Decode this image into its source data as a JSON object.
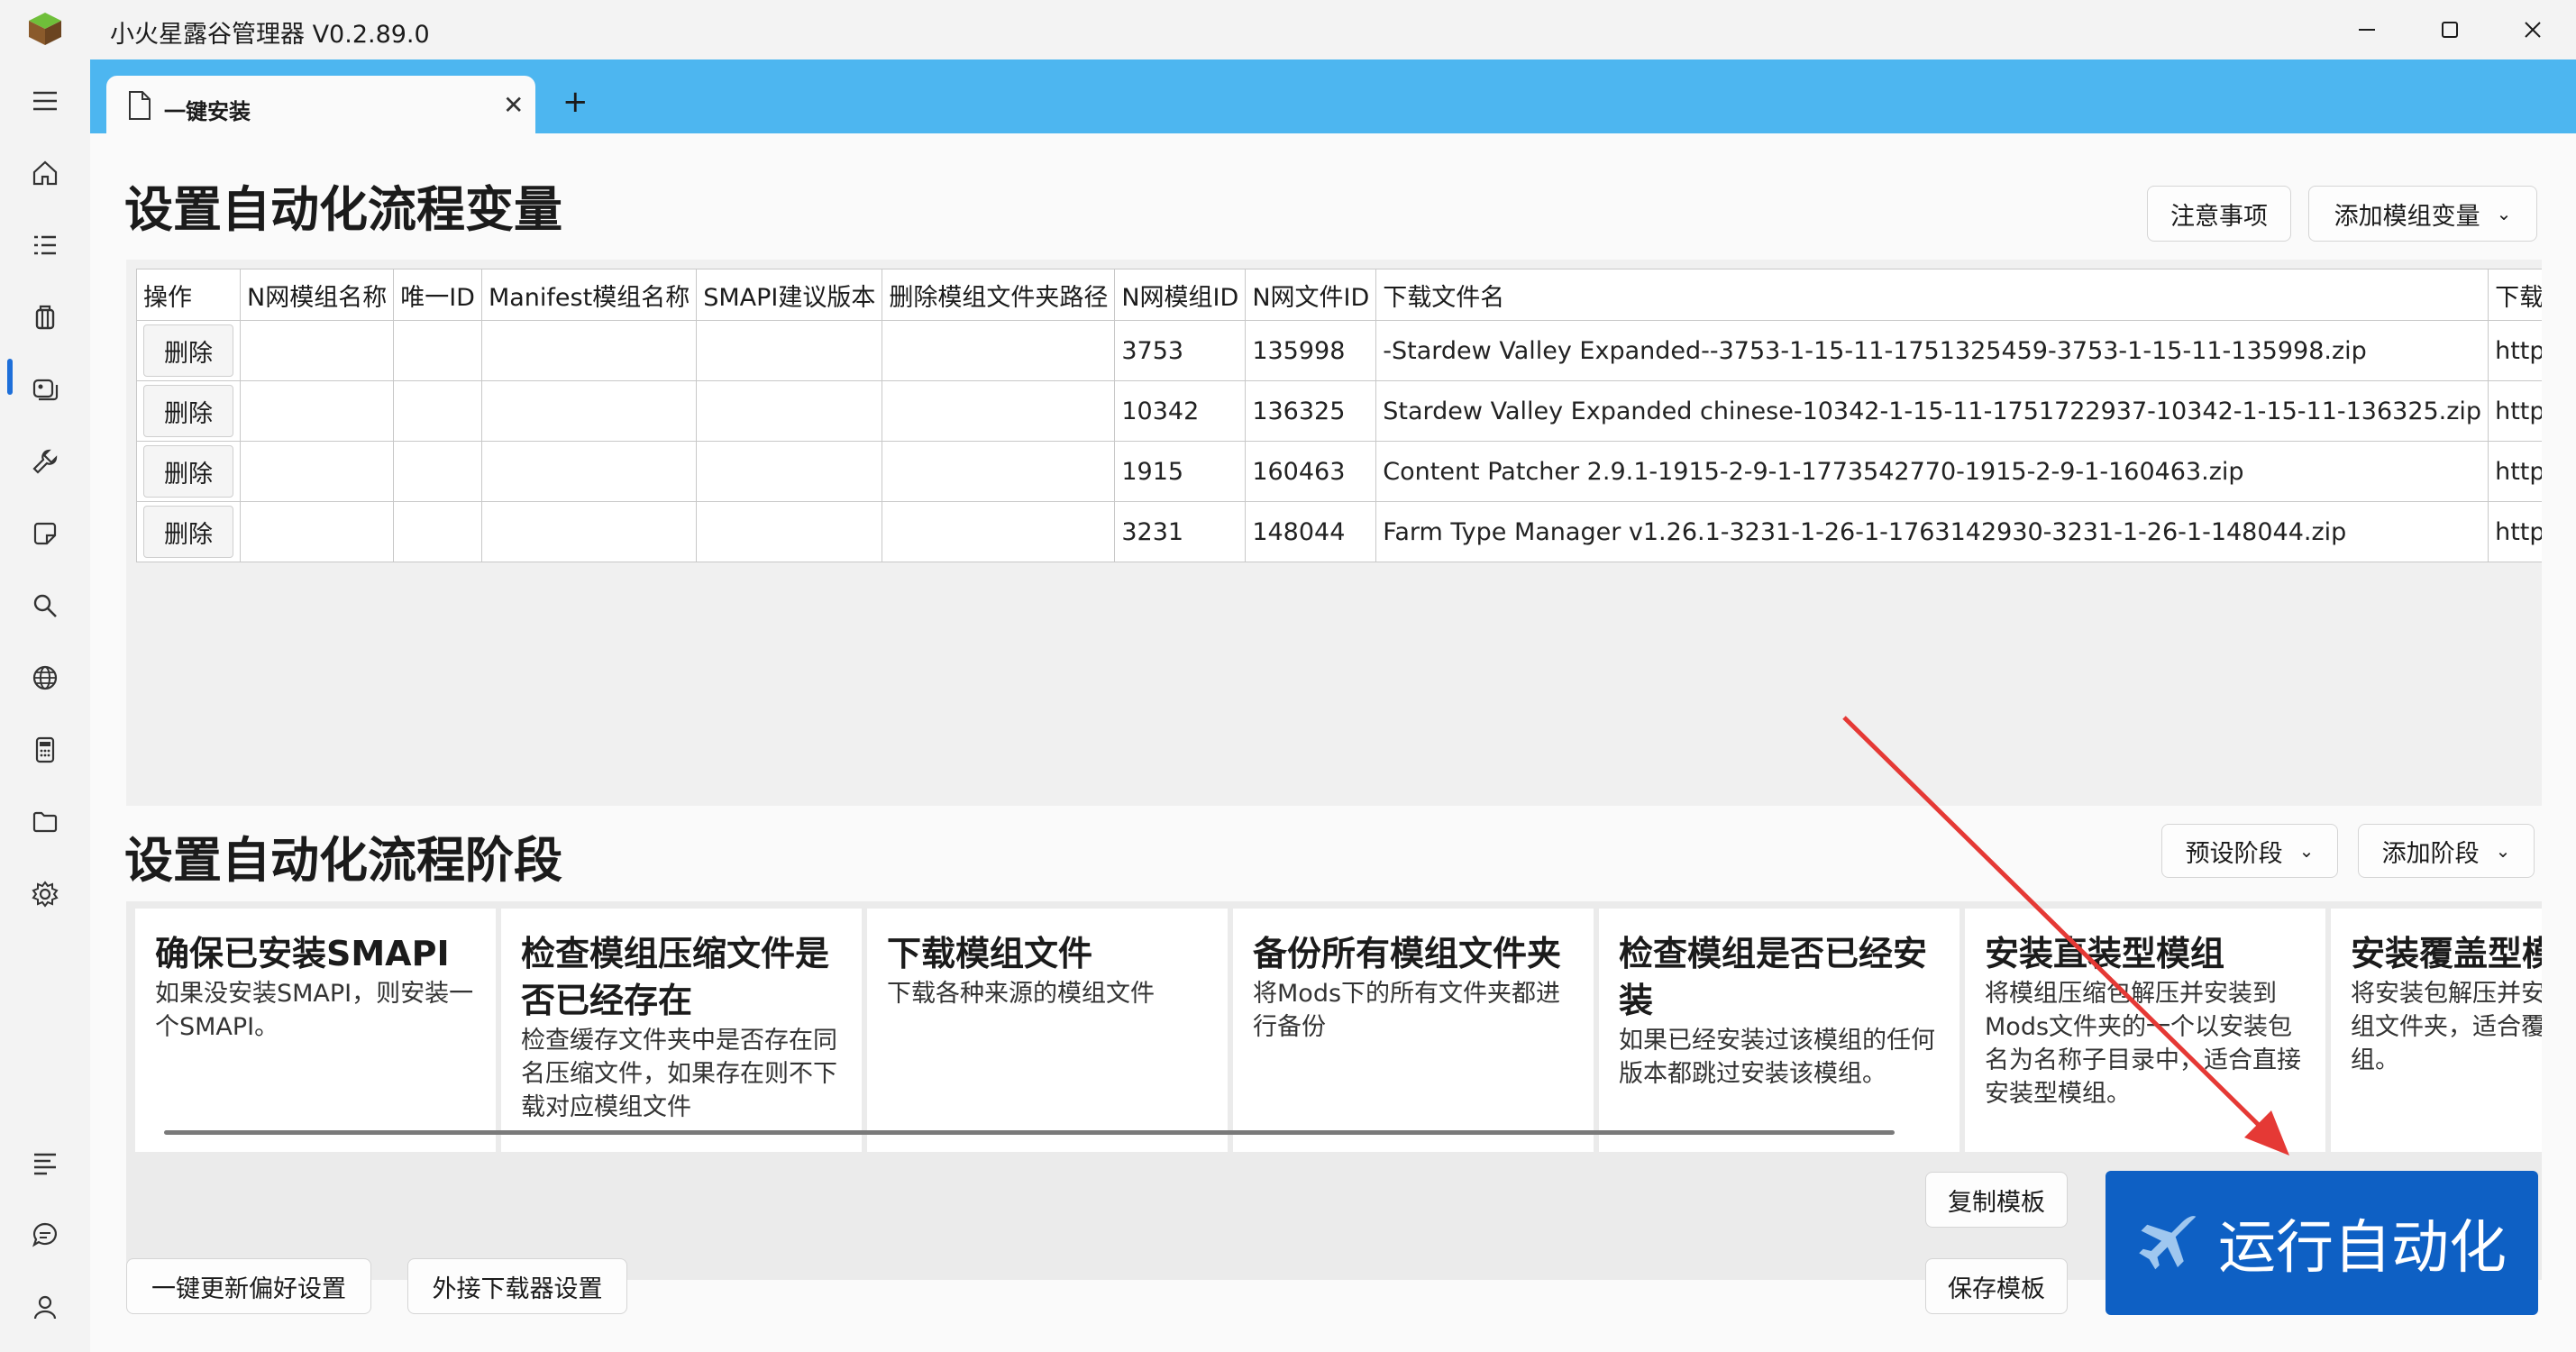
{
  "app": {
    "title": "小火星露谷管理器 V0.2.89.0"
  },
  "window_controls": {
    "minimize_icon": "minimize-icon",
    "maximize_icon": "maximize-icon",
    "close_icon": "close-icon"
  },
  "sidebar": {
    "icons": [
      "hamburger-menu-icon",
      "home-icon",
      "list-icon",
      "package-icon",
      "images-icon",
      "wrench-icon",
      "note-icon",
      "search-icon",
      "globe-icon",
      "calculator-icon",
      "folder-icon",
      "settings-icon",
      "menu-lines-icon",
      "chat-icon",
      "user-icon"
    ],
    "active": "package-icon"
  },
  "tabs": [
    {
      "label": "一键安装"
    }
  ],
  "variables_section": {
    "title": "设置自动化流程变量",
    "notes_button": "注意事项",
    "add_variable_button": "添加模组变量"
  },
  "variables_table": {
    "columns": [
      "操作",
      "N网模组名称",
      "唯一ID",
      "Manifest模组名称",
      "SMAPI建议版本",
      "删除模组文件夹路径",
      "N网模组ID",
      "N网文件ID",
      "下载文件名",
      "下载页"
    ],
    "visible_header_last": "下载页",
    "delete_label": "删除",
    "rows": [
      {
        "nexus_mod_id": "3753",
        "nexus_file_id": "135998",
        "file_name": "-Stardew Valley Expanded--3753-1-15-11-1751325459-3753-1-15-11-135998.zip",
        "url": "https"
      },
      {
        "nexus_mod_id": "10342",
        "nexus_file_id": "136325",
        "file_name": "Stardew Valley Expanded chinese-10342-1-15-11-1751722937-10342-1-15-11-136325.zip",
        "url": "https"
      },
      {
        "nexus_mod_id": "1915",
        "nexus_file_id": "160463",
        "file_name": "Content Patcher 2.9.1-1915-2-9-1-1773542770-1915-2-9-1-160463.zip",
        "url": "https"
      },
      {
        "nexus_mod_id": "3231",
        "nexus_file_id": "148044",
        "file_name": "Farm Type Manager v1.26.1-3231-1-26-1-1763142930-3231-1-26-1-148044.zip",
        "url": "https"
      }
    ]
  },
  "stages_section": {
    "title": "设置自动化流程阶段",
    "preset_button": "预设阶段",
    "add_stage_button": "添加阶段",
    "stages": [
      {
        "title": "确保已安装SMAPI",
        "desc": "如果没安装SMAPI，则安装一个SMAPI。"
      },
      {
        "title": "检查模组压缩文件是否已经存在",
        "desc": "检查缓存文件夹中是否存在同名压缩文件，如果存在则不下载对应模组文件"
      },
      {
        "title": "下载模组文件",
        "desc": "下载各种来源的模组文件"
      },
      {
        "title": "备份所有模组文件夹",
        "desc": "将Mods下的所有文件夹都进行备份"
      },
      {
        "title": "检查模组是否已经安装",
        "desc": "如果已经安装过该模组的任何版本都跳过安装该模组。"
      },
      {
        "title": "安装直装型模组",
        "desc": "将模组压缩包解压并安装到Mods文件夹的一个以安装包名为名称子目录中，适合直接安装型模组。"
      },
      {
        "title": "安装覆盖型模组",
        "desc": "将安装包解压并安装的一个模组文件夹，适合覆盖型安装模组。"
      }
    ]
  },
  "footer": {
    "update_prefs_button": "一键更新偏好设置",
    "downloader_settings_button": "外接下载器设置",
    "copy_template_button": "复制模板",
    "save_template_button": "保存模板",
    "run_button": "运行自动化"
  },
  "colors": {
    "tabbar": "#4db6f0",
    "accent": "#0e60c4",
    "arrow": "#e53935"
  }
}
